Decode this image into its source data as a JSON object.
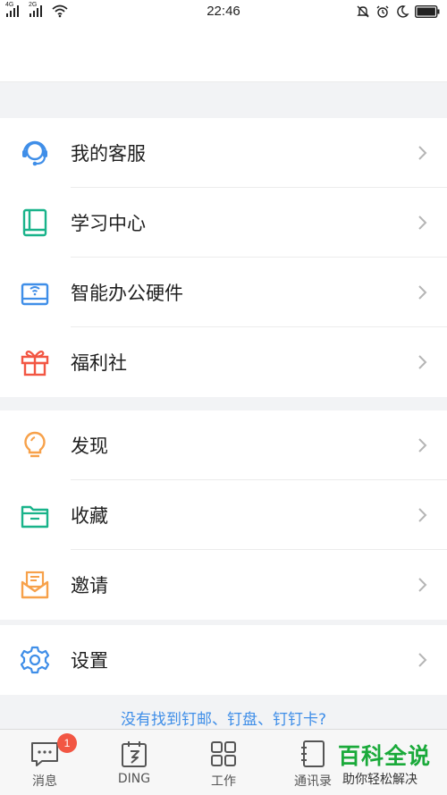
{
  "status_bar": {
    "sim1": "4G",
    "sim2": "2G",
    "time": "22:46"
  },
  "groups": [
    {
      "items": [
        {
          "label": "我的客服",
          "icon": "customer-service-icon",
          "color": "#3f8ee8"
        },
        {
          "label": "学习中心",
          "icon": "book-icon",
          "color": "#19b38a"
        },
        {
          "label": "智能办公硬件",
          "icon": "hardware-device-icon",
          "color": "#3f8ee8"
        },
        {
          "label": "福利社",
          "icon": "gift-icon",
          "color": "#f25643"
        }
      ]
    },
    {
      "items": [
        {
          "label": "发现",
          "icon": "lightbulb-icon",
          "color": "#f7a14a"
        },
        {
          "label": "收藏",
          "icon": "folder-icon",
          "color": "#19b38a"
        },
        {
          "label": "邀请",
          "icon": "invite-envelope-icon",
          "color": "#f7a14a"
        }
      ]
    },
    {
      "items": [
        {
          "label": "设置",
          "icon": "gear-icon",
          "color": "#3f8ee8"
        }
      ]
    }
  ],
  "footer_link": "没有找到钉邮、钉盘、钉钉卡?",
  "tabbar": {
    "tabs": [
      {
        "label": "消息",
        "icon": "message-icon",
        "badge": "1"
      },
      {
        "label": "DING",
        "icon": "ding-icon"
      },
      {
        "label": "工作",
        "icon": "grid-icon"
      },
      {
        "label": "通讯录",
        "icon": "contacts-icon"
      }
    ]
  },
  "watermark": {
    "title": "百科全说",
    "subtitle": "助你轻松解决"
  }
}
